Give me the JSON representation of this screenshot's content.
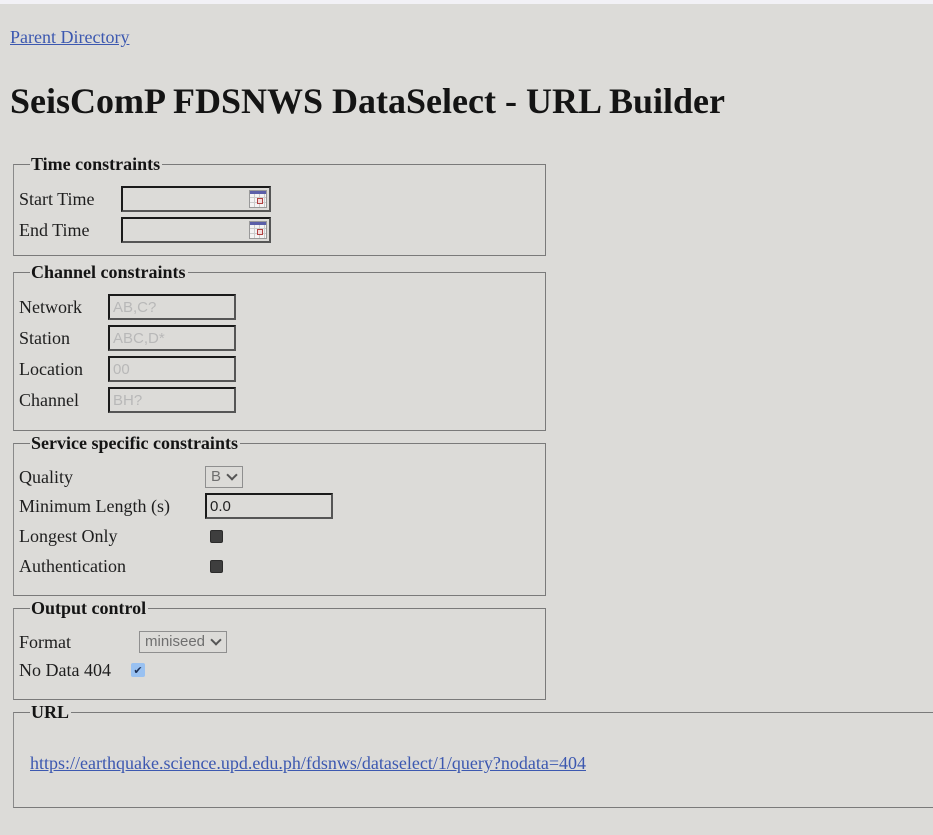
{
  "nav": {
    "parent_link": "Parent Directory"
  },
  "page_title": "SeisComP FDSNWS DataSelect - URL Builder",
  "time_constraints": {
    "legend": "Time constraints",
    "start_time": {
      "label": "Start Time",
      "value": "",
      "icon": "calendar-icon"
    },
    "end_time": {
      "label": "End Time",
      "value": "",
      "icon": "calendar-icon"
    }
  },
  "channel_constraints": {
    "legend": "Channel constraints",
    "network": {
      "label": "Network",
      "value": "",
      "placeholder": "AB,C?"
    },
    "station": {
      "label": "Station",
      "value": "",
      "placeholder": "ABC,D*"
    },
    "location": {
      "label": "Location",
      "value": "",
      "placeholder": "00"
    },
    "channel": {
      "label": "Channel",
      "value": "",
      "placeholder": "BH?"
    }
  },
  "service_constraints": {
    "legend": "Service specific constraints",
    "quality": {
      "label": "Quality",
      "selected": "B"
    },
    "minimum_length": {
      "label": "Minimum Length (s)",
      "value": "0.0"
    },
    "longest_only": {
      "label": "Longest Only",
      "checked": false
    },
    "authentication": {
      "label": "Authentication",
      "checked": false
    }
  },
  "output_control": {
    "legend": "Output control",
    "format": {
      "label": "Format",
      "selected": "miniseed"
    },
    "no_data_404": {
      "label": "No Data 404",
      "checked": true,
      "check_glyph": "✔"
    }
  },
  "url_section": {
    "legend": "URL",
    "url": "https://earthquake.science.upd.edu.ph/fdsnws/dataselect/1/query?nodata=404"
  },
  "colors": {
    "background": "#dcdbd8",
    "link": "#3c58b0",
    "checkbox_checked": "#99c1f1"
  }
}
